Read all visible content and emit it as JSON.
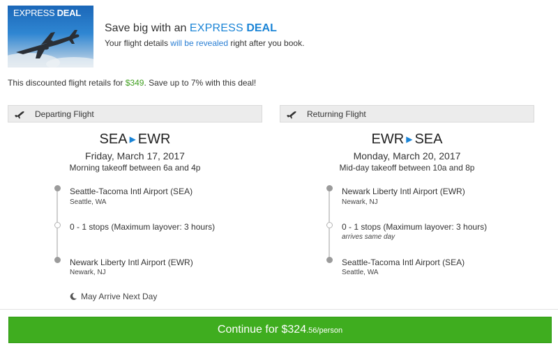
{
  "header": {
    "badge_main": "EXPRESS",
    "badge_bold": "DEAL",
    "title_prefix": "Save big with an ",
    "title_express": "EXPRESS",
    "title_deal": "DEAL",
    "subtitle_before": "Your flight details ",
    "subtitle_link": "will be revealed",
    "subtitle_after": " right after you book."
  },
  "discount": {
    "before": "This discounted flight retails for ",
    "price": "$349",
    "after": ". Save up to 7% with this deal!"
  },
  "departing": {
    "header_label": "Departing Flight",
    "icon": "plane-takeoff-icon",
    "origin": "SEA",
    "destination": "EWR",
    "date": "Friday, March 17, 2017",
    "takeoff": "Morning takeoff between 6a and 4p",
    "stops": [
      {
        "main": "Seattle-Tacoma Intl Airport (SEA)",
        "sub": "Seattle, WA"
      },
      {
        "main": "0 - 1 stops (Maximum layover: 3 hours)",
        "sub": ""
      },
      {
        "main": "Newark Liberty Intl Airport (EWR)",
        "sub": "Newark, NJ"
      }
    ],
    "arrival_note": "May Arrive Next Day",
    "arrival_icon": "moon-icon"
  },
  "returning": {
    "header_label": "Returning Flight",
    "icon": "plane-takeoff-icon",
    "origin": "EWR",
    "destination": "SEA",
    "date": "Monday, March 20, 2017",
    "takeoff": "Mid-day takeoff between 10a and 8p",
    "stops": [
      {
        "main": "Newark Liberty Intl Airport (EWR)",
        "sub": "Newark, NJ"
      },
      {
        "main": "0 - 1 stops (Maximum layover: 3 hours)",
        "sub": "arrives same day"
      },
      {
        "main": "Seattle-Tacoma Intl Airport (SEA)",
        "sub": "Seattle, WA"
      }
    ]
  },
  "cta": {
    "label": "Continue for ",
    "dollars": "$324",
    "cents": ".56",
    "per": "/person"
  },
  "colors": {
    "accent_blue": "#1a84d6",
    "price_green": "#3f9f1f",
    "button_green": "#3fad1f"
  }
}
